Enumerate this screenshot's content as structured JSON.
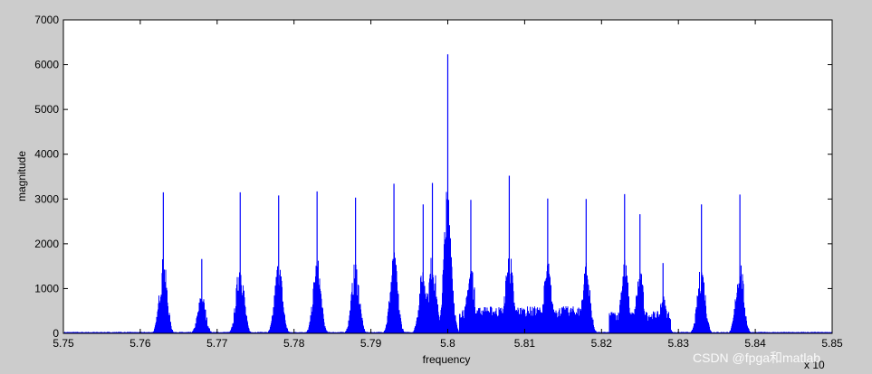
{
  "chart_data": {
    "type": "line",
    "title": "",
    "xlabel": "frequency",
    "ylabel": "magnitude",
    "x_multiplier_label": "x 10",
    "xlim": [
      5.75,
      5.85
    ],
    "ylim": [
      0,
      7000
    ],
    "x_ticks": [
      "5.75",
      "5.76",
      "5.77",
      "5.78",
      "5.79",
      "5.8",
      "5.81",
      "5.82",
      "5.83",
      "5.84",
      "5.85"
    ],
    "y_ticks": [
      "0",
      "1000",
      "2000",
      "3000",
      "4000",
      "5000",
      "6000",
      "7000"
    ],
    "grid": false,
    "color": "#0000ff",
    "peaks": [
      {
        "x": 5.763,
        "y": 3150
      },
      {
        "x": 5.768,
        "y": 1660
      },
      {
        "x": 5.773,
        "y": 3150
      },
      {
        "x": 5.778,
        "y": 3080
      },
      {
        "x": 5.783,
        "y": 3170
      },
      {
        "x": 5.788,
        "y": 3030
      },
      {
        "x": 5.793,
        "y": 3340
      },
      {
        "x": 5.7968,
        "y": 2880
      },
      {
        "x": 5.798,
        "y": 3360
      },
      {
        "x": 5.8,
        "y": 6230
      },
      {
        "x": 5.803,
        "y": 2980
      },
      {
        "x": 5.808,
        "y": 3520
      },
      {
        "x": 5.813,
        "y": 3010
      },
      {
        "x": 5.818,
        "y": 3000
      },
      {
        "x": 5.823,
        "y": 3110
      },
      {
        "x": 5.825,
        "y": 2660
      },
      {
        "x": 5.828,
        "y": 1570
      },
      {
        "x": 5.833,
        "y": 2880
      },
      {
        "x": 5.838,
        "y": 3100
      }
    ]
  },
  "watermark": "CSDN @fpga和matlab"
}
